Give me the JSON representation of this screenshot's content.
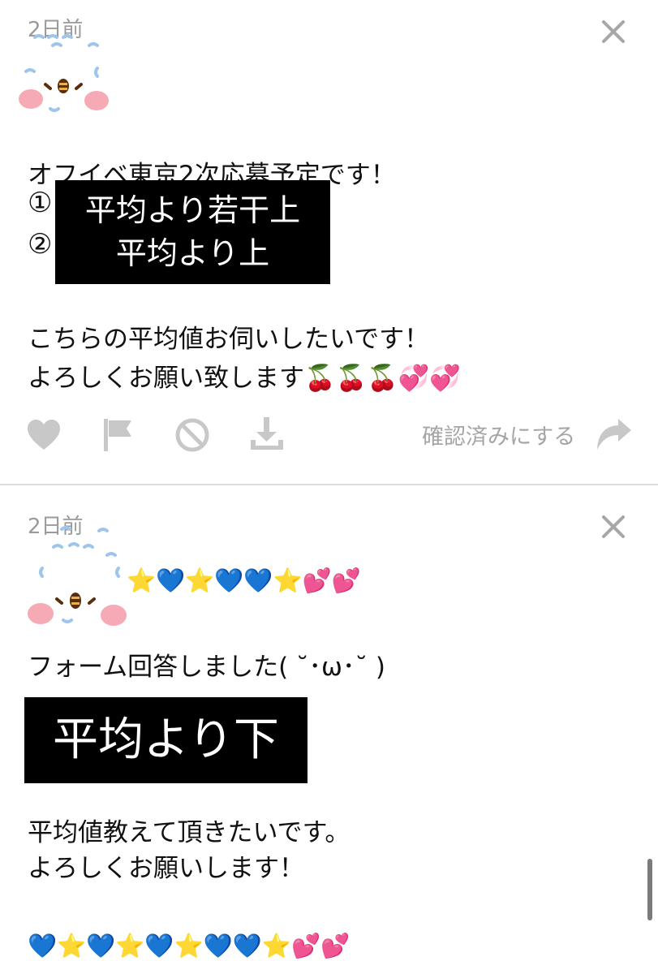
{
  "messages": [
    {
      "time": "2日前",
      "line1": "オフイベ東京2次応募予定です！",
      "circle_1": "①",
      "circle_2": "②",
      "box_line_1": "平均より若干上",
      "box_line_2": "平均より上",
      "line2": "こちらの平均値お伺いしたいです！",
      "line3": "よろしくお願い致します🍒🍒🍒💞💞",
      "verify_label": "確認済みにする"
    },
    {
      "time": "2日前",
      "emoji_row": "⭐💙⭐💙💙⭐💕💕",
      "line1": "フォーム回答しました( ˘･ω･˘ )",
      "box": "平均より下",
      "line2": "平均値教えて頂きたいです。",
      "line3": "よろしくお願いします！",
      "line4": "💙⭐💙⭐💙⭐💙💙⭐💕💕"
    }
  ],
  "icons": {
    "heart": "heart-icon",
    "flag": "flag-icon",
    "block": "block-icon",
    "download": "download-icon",
    "share": "share-icon",
    "close": "close-icon",
    "character": "kanahei-character-icon"
  },
  "colors": {
    "icon_gray": "#c8c8c8",
    "text_gray": "#9a9a9a",
    "blush": "#f6aab6",
    "tear_blue": "#9ec5ec"
  }
}
